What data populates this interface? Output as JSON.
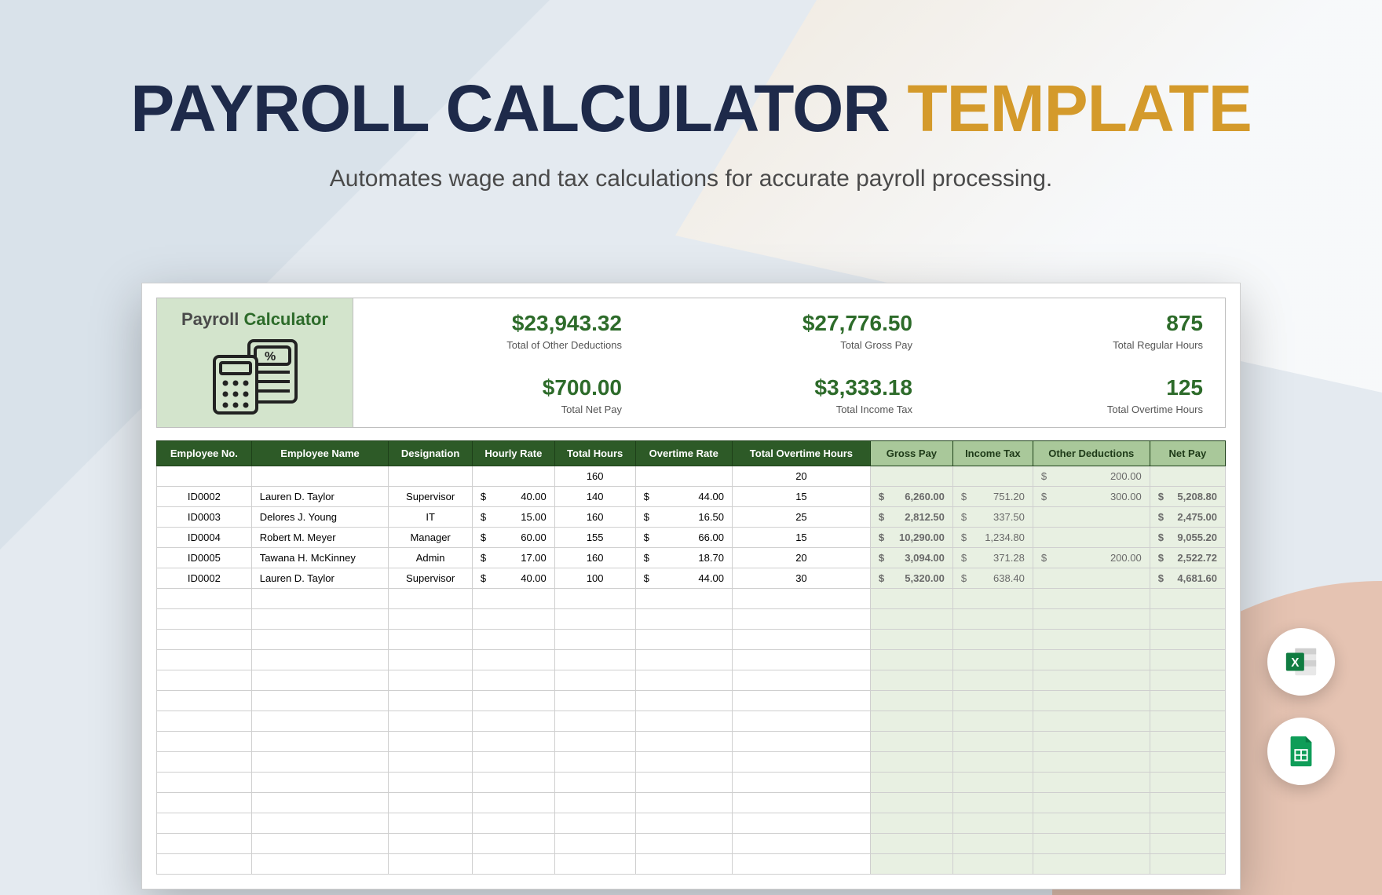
{
  "title": {
    "part1": "PAYROLL CALCULATOR",
    "part2": "TEMPLATE"
  },
  "subtitle": "Automates wage and tax calculations for accurate payroll processing.",
  "logo": {
    "part1": "Payroll",
    "part2": "Calculator"
  },
  "metrics": {
    "total_other_deductions": {
      "value": "$23,943.32",
      "label": "Total of Other Deductions"
    },
    "total_gross_pay": {
      "value": "$27,776.50",
      "label": "Total Gross Pay"
    },
    "total_regular_hours": {
      "value": "875",
      "label": "Total Regular Hours"
    },
    "total_net_pay": {
      "value": "$700.00",
      "label": "Total Net Pay"
    },
    "total_income_tax": {
      "value": "$3,333.18",
      "label": "Total Income Tax"
    },
    "total_overtime_hours": {
      "value": "125",
      "label": "Total Overtime Hours"
    }
  },
  "columns": {
    "employee_no": "Employee No.",
    "employee_name": "Employee Name",
    "designation": "Designation",
    "hourly_rate": "Hourly Rate",
    "total_hours": "Total Hours",
    "overtime_rate": "Overtime Rate",
    "total_overtime_hours": "Total Overtime Hours",
    "gross_pay": "Gross Pay",
    "income_tax": "Income Tax",
    "other_deductions": "Other Deductions",
    "net_pay": "Net Pay"
  },
  "rows": [
    {
      "employee_no": "",
      "employee_name": "",
      "designation": "",
      "hourly_rate": "",
      "total_hours": "160",
      "overtime_rate": "",
      "total_overtime_hours": "20",
      "gross_pay": "",
      "income_tax": "",
      "other_deductions": "200.00",
      "net_pay": ""
    },
    {
      "employee_no": "ID0002",
      "employee_name": "Lauren D. Taylor",
      "designation": "Supervisor",
      "hourly_rate": "40.00",
      "total_hours": "140",
      "overtime_rate": "44.00",
      "total_overtime_hours": "15",
      "gross_pay": "6,260.00",
      "income_tax": "751.20",
      "other_deductions": "300.00",
      "net_pay": "5,208.80"
    },
    {
      "employee_no": "ID0003",
      "employee_name": "Delores J. Young",
      "designation": "IT",
      "hourly_rate": "15.00",
      "total_hours": "160",
      "overtime_rate": "16.50",
      "total_overtime_hours": "25",
      "gross_pay": "2,812.50",
      "income_tax": "337.50",
      "other_deductions": "",
      "net_pay": "2,475.00"
    },
    {
      "employee_no": "ID0004",
      "employee_name": "Robert M. Meyer",
      "designation": "Manager",
      "hourly_rate": "60.00",
      "total_hours": "155",
      "overtime_rate": "66.00",
      "total_overtime_hours": "15",
      "gross_pay": "10,290.00",
      "income_tax": "1,234.80",
      "other_deductions": "",
      "net_pay": "9,055.20"
    },
    {
      "employee_no": "ID0005",
      "employee_name": "Tawana H. McKinney",
      "designation": "Admin",
      "hourly_rate": "17.00",
      "total_hours": "160",
      "overtime_rate": "18.70",
      "total_overtime_hours": "20",
      "gross_pay": "3,094.00",
      "income_tax": "371.28",
      "other_deductions": "200.00",
      "net_pay": "2,522.72"
    },
    {
      "employee_no": "ID0002",
      "employee_name": "Lauren D. Taylor",
      "designation": "Supervisor",
      "hourly_rate": "40.00",
      "total_hours": "100",
      "overtime_rate": "44.00",
      "total_overtime_hours": "30",
      "gross_pay": "5,320.00",
      "income_tax": "638.40",
      "other_deductions": "",
      "net_pay": "4,681.60"
    }
  ],
  "icons": {
    "excel": "excel-icon",
    "sheets": "sheets-icon"
  },
  "colors": {
    "dark_green": "#2d5a27",
    "green": "#2d6b2a",
    "navy": "#1e2a4a",
    "gold": "#d49a2b"
  }
}
